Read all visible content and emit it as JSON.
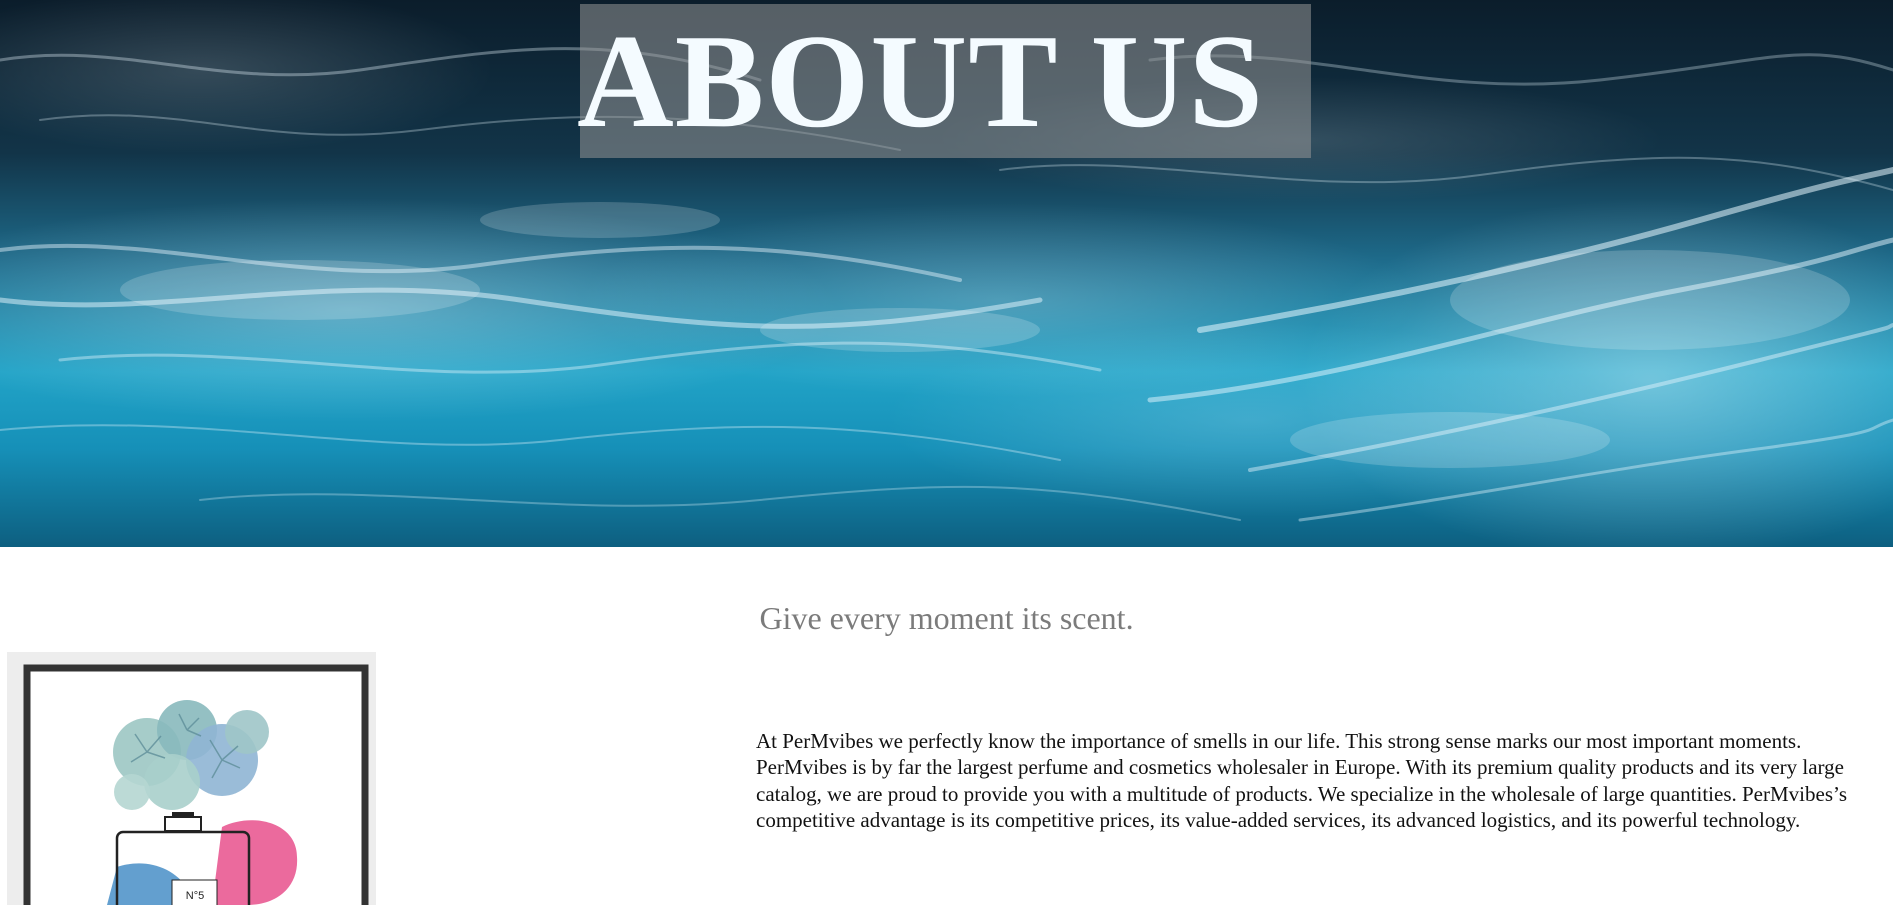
{
  "hero": {
    "title": "ABOUT US"
  },
  "tagline": "Give every moment its scent.",
  "about": {
    "paragraph": "At PerMvibes we perfectly know the importance of smells in our life. This strong sense marks our most important moments. PerMvibes is by far the largest perfume and cosmetics wholesaler in Europe. With its premium quality products and its very large catalog, we are proud to provide you with a multitude of products. We specialize in the wholesale of large quantities. PerMvibes’s competitive advantage is its competitive prices, its value-added services, its advanced logistics, and its powerful technology."
  },
  "poster": {
    "bottle_label": "N°5"
  },
  "colors": {
    "tagline": "#7b7b7b",
    "body_text": "#111111",
    "title_text": "#f4fbff",
    "title_box": "#969696",
    "ocean_dark": "#0b1d2b",
    "ocean_bright": "#21a3c7"
  }
}
